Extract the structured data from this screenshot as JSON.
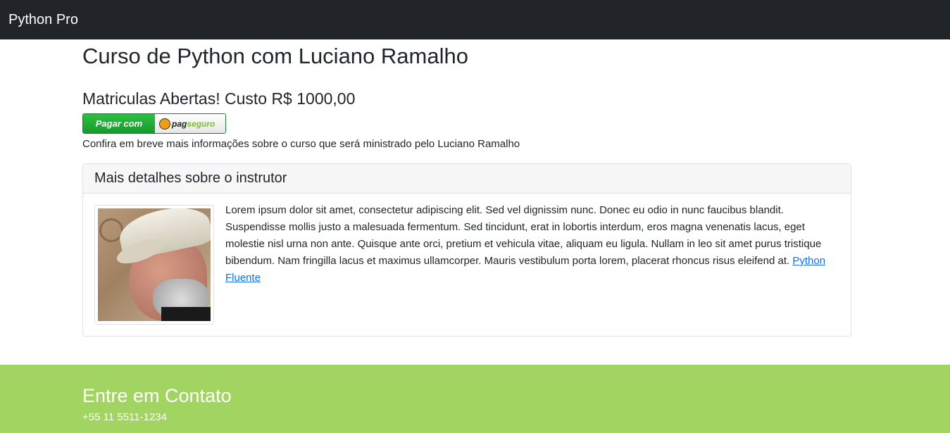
{
  "navbar": {
    "brand": "Python Pro"
  },
  "main": {
    "title": "Curso de Python com Luciano Ramalho",
    "subtitle": "Matriculas Abertas! Custo R$ 1000,00",
    "pay_button": {
      "left_label": "Pagar com",
      "logo_pag": "pag",
      "logo_seguro": "seguro"
    },
    "note": "Confira em breve mais informações sobre o curso que será ministrado pelo Luciano Ramalho"
  },
  "instructor_card": {
    "header": "Mais detalhes sobre o instrutor",
    "bio": "Lorem ipsum dolor sit amet, consectetur adipiscing elit. Sed vel dignissim nunc. Donec eu odio in nunc faucibus blandit. Suspendisse mollis justo a malesuada fermentum. Sed tincidunt, erat in lobortis interdum, eros magna venenatis lacus, eget molestie nisl urna non ante. Quisque ante orci, pretium et vehicula vitae, aliquam eu ligula. Nullam in leo sit amet purus tristique bibendum. Nam fringilla lacus et maximus ullamcorper. Mauris vestibulum porta lorem, placerat rhoncus risus eleifend at.",
    "link_label": "Python Fluente"
  },
  "footer": {
    "title": "Entre em Contato",
    "phone": "+55 11 5511-1234"
  },
  "colors": {
    "navbar_bg": "#212529",
    "footer_bg": "#a2d462",
    "link": "#0d6efd"
  }
}
